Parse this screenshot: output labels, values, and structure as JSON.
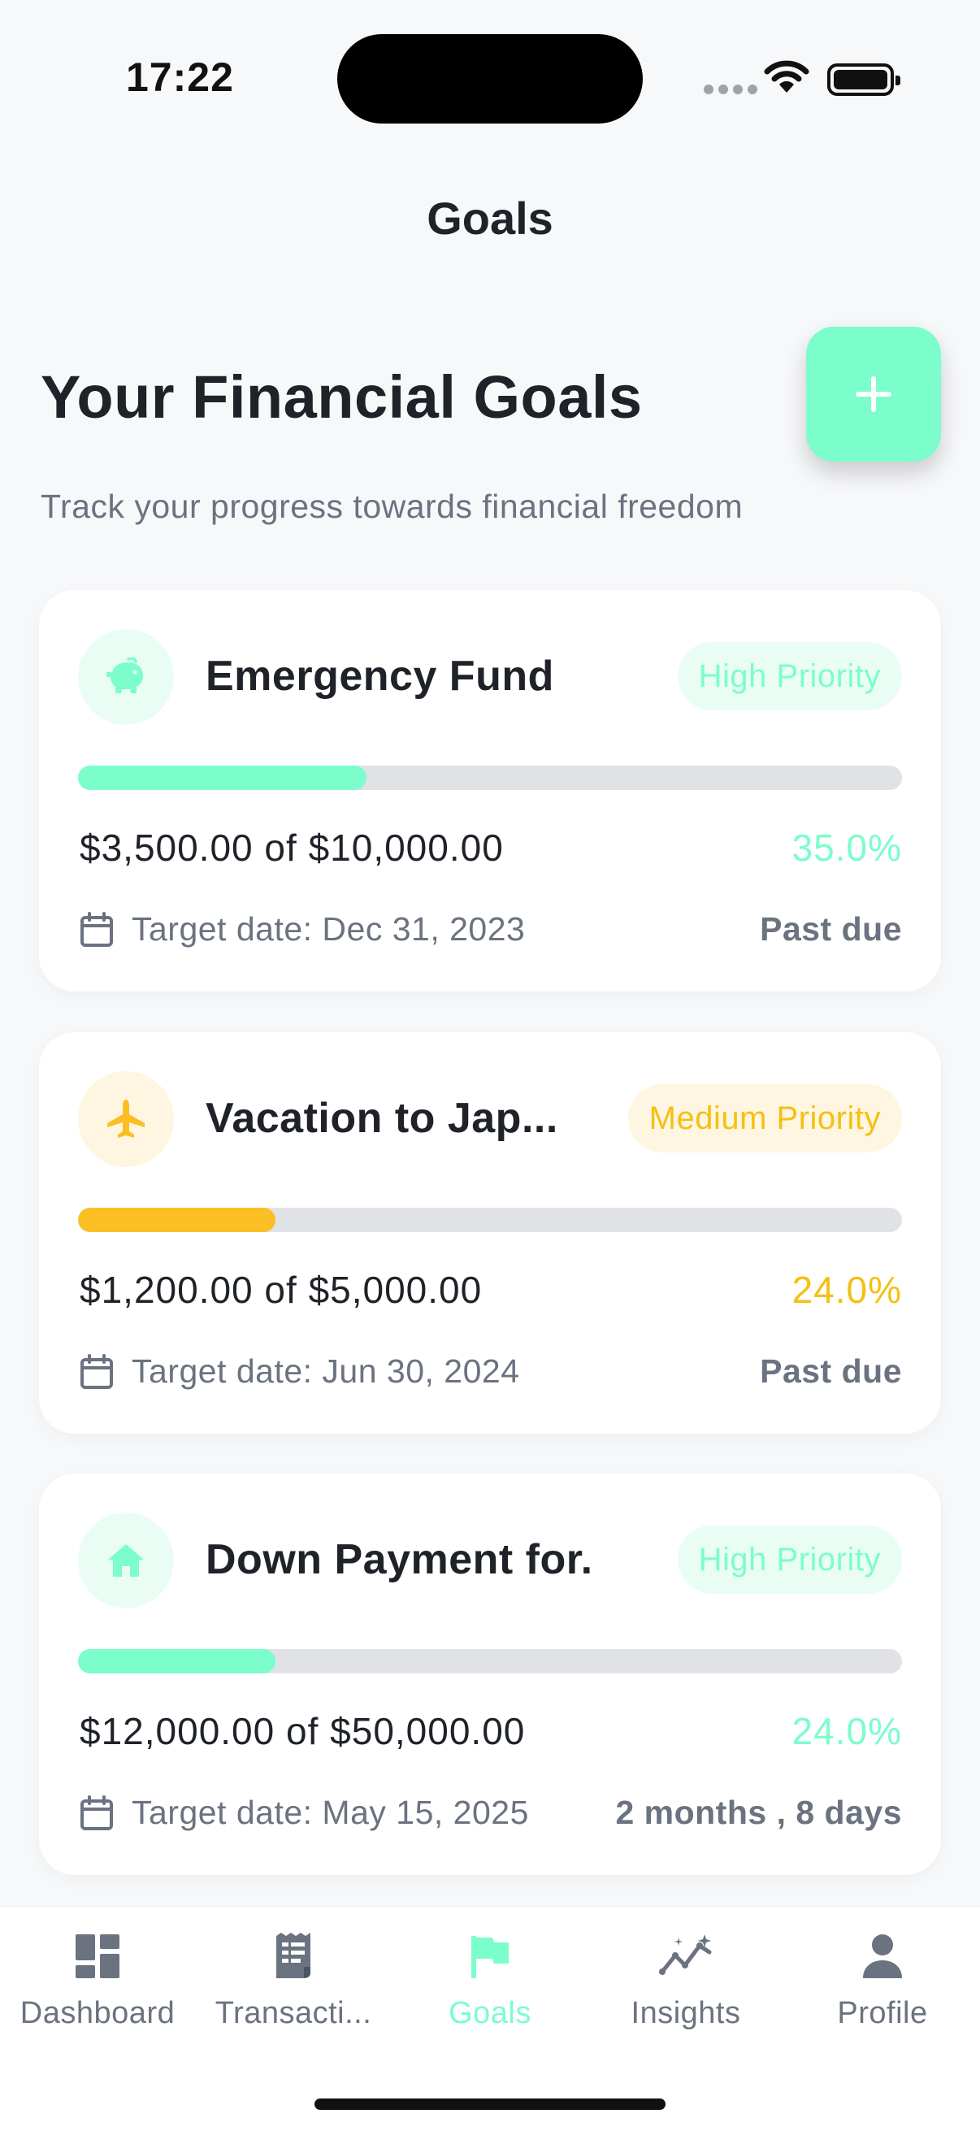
{
  "status_bar": {
    "time": "17:22"
  },
  "header": {
    "title": "Goals"
  },
  "page": {
    "heading": "Your Financial Goals",
    "subtitle": "Track your progress towards financial freedom",
    "add_icon": "plus-icon"
  },
  "goals": [
    {
      "name": "Emergency Fund",
      "icon": "piggy-bank-icon",
      "priority": "High Priority",
      "amount": "$3,500.00 of $10,000.00",
      "percent": "35.0%",
      "progress": 0.35,
      "date": "Target date: Dec 31, 2023",
      "remaining": "Past due",
      "accent": "#7bfdcc"
    },
    {
      "name": "Vacation to Jap...",
      "icon": "airplane-icon",
      "priority": "Medium Priority",
      "amount": "$1,200.00 of $5,000.00",
      "percent": "24.0%",
      "progress": 0.24,
      "date": "Target date: Jun 30, 2024",
      "remaining": "Past due",
      "accent": "#fbbf24"
    },
    {
      "name": "Down Payment for...",
      "icon": "house-icon",
      "priority": "High Priority",
      "amount": "$12,000.00 of $50,000.00",
      "percent": "24.0%",
      "progress": 0.24,
      "date": "Target date: May 15, 2025",
      "remaining": "2 months , 8 days",
      "accent": "#7bfdcc"
    }
  ],
  "tabs": [
    {
      "label": "Dashboard",
      "icon": "dashboard-icon",
      "active": false
    },
    {
      "label": "Transacti...",
      "icon": "receipt-icon",
      "active": false
    },
    {
      "label": "Goals",
      "icon": "flag-icon",
      "active": true
    },
    {
      "label": "Insights",
      "icon": "insights-icon",
      "active": false
    },
    {
      "label": "Profile",
      "icon": "person-icon",
      "active": false
    }
  ],
  "colors": {
    "accent": "#7bfdcc",
    "medium": "#fbbf24",
    "background": "#f7f8fa"
  }
}
